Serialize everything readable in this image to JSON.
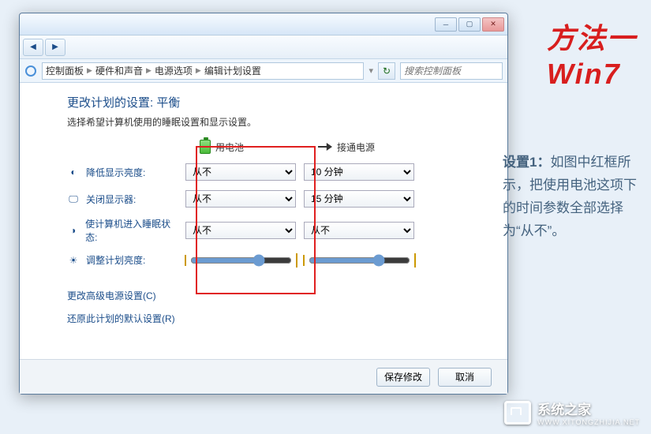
{
  "breadcrumb": {
    "a": "控制面板",
    "b": "硬件和声音",
    "c": "电源选项",
    "d": "编辑计划设置"
  },
  "search_placeholder": "搜索控制面板",
  "page": {
    "title": "更改计划的设置: 平衡",
    "subtitle": "选择希望计算机使用的睡眠设置和显示设置。"
  },
  "columns": {
    "battery": "用电池",
    "plugged": "接通电源"
  },
  "rows": {
    "dim": {
      "label": "降低显示亮度:",
      "battery": "从不",
      "plugged": "10 分钟"
    },
    "off": {
      "label": "关闭显示器:",
      "battery": "从不",
      "plugged": "15 分钟"
    },
    "sleep": {
      "label": "使计算机进入睡眠状态:",
      "battery": "从不",
      "plugged": "从不"
    },
    "bright": {
      "label": "调整计划亮度:"
    }
  },
  "links": {
    "advanced": "更改高级电源设置(C)",
    "restore": "还原此计划的默认设置(R)"
  },
  "buttons": {
    "save": "保存修改",
    "cancel": "取消"
  },
  "side": {
    "title1": "方法一",
    "title2": "Win7",
    "step": "设置1：",
    "desc": "如图中红框所示，把使用电池这项下的时间参数全部选择为“从不”。"
  },
  "watermark": {
    "name": "系统之家",
    "url": "WWW.XITONGZHIJIA.NET"
  }
}
